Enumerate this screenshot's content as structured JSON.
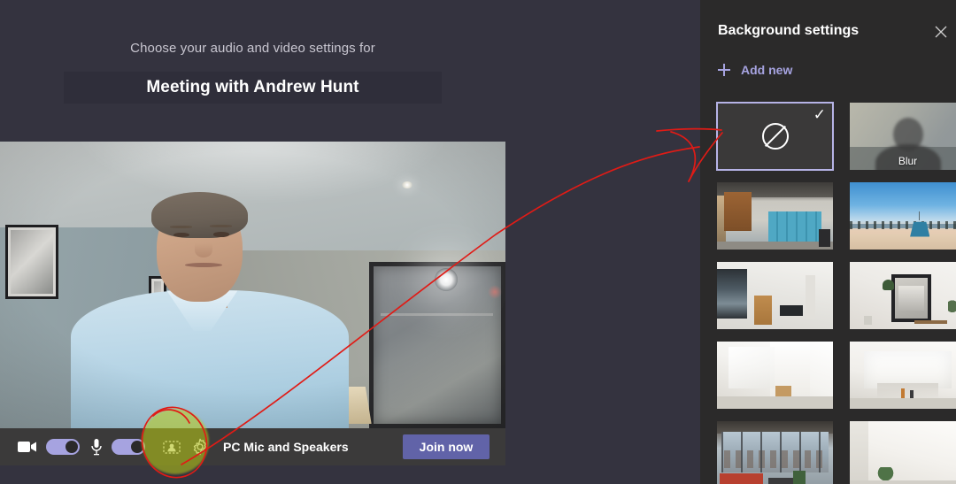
{
  "prejoin": {
    "subtitle": "Choose your audio and video settings for",
    "meeting_title": "Meeting with Andrew Hunt"
  },
  "toolbar": {
    "camera_icon": "video-camera-icon",
    "camera_toggle_state": "on",
    "mic_icon": "microphone-icon",
    "mic_toggle_state": "on",
    "background_effects_icon": "background-effects-icon",
    "settings_icon": "gear-icon",
    "device_label": "PC Mic and Speakers",
    "join_label": "Join now",
    "join_button_color": "#6163a8",
    "toggle_on_color": "#a6a3e0"
  },
  "background_panel": {
    "title": "Background settings",
    "close_icon": "close-icon",
    "add_new_label": "Add new",
    "add_new_icon": "plus-icon",
    "add_new_color": "#a6a3e0",
    "selected_border_color": "#b6b3e6",
    "check_glyph": "✓",
    "thumbnails": [
      {
        "name": "None",
        "scene": "sc-none",
        "selected": true,
        "label": ""
      },
      {
        "name": "Blur",
        "scene": "sc-blur",
        "selected": false,
        "label": "Blur"
      },
      {
        "name": "Office lockers",
        "scene": "sc-office",
        "selected": false,
        "label": ""
      },
      {
        "name": "Beach boardwalk",
        "scene": "sc-beach",
        "selected": false,
        "label": ""
      },
      {
        "name": "Bright room",
        "scene": "sc-room1",
        "selected": false,
        "label": ""
      },
      {
        "name": "Room with mirror",
        "scene": "sc-mirror",
        "selected": false,
        "label": ""
      },
      {
        "name": "White interior",
        "scene": "sc-white1",
        "selected": false,
        "label": ""
      },
      {
        "name": "White studio",
        "scene": "sc-white2",
        "selected": false,
        "label": ""
      },
      {
        "name": "Loft office",
        "scene": "sc-loft",
        "selected": false,
        "label": ""
      },
      {
        "name": "Plain wall",
        "scene": "sc-plain",
        "selected": false,
        "label": ""
      }
    ]
  },
  "annotations": {
    "arrow_color": "#e01b16",
    "highlight_color": "#becd14",
    "description": "red hand-drawn arrow from background-effects button to the None background tile"
  }
}
